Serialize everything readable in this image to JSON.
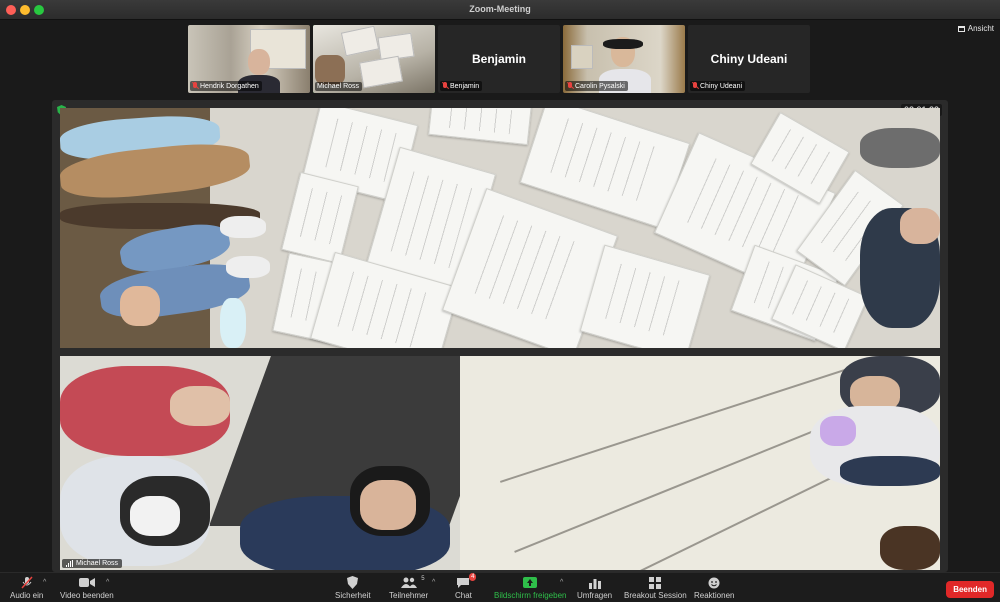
{
  "window": {
    "title": "Zoom-Meeting"
  },
  "view": {
    "label": "Ansicht"
  },
  "participants": [
    {
      "name": "Hendrik Dorgathen",
      "video": true,
      "muted": true,
      "active": false
    },
    {
      "name": "Michael Ross",
      "video": true,
      "muted": false,
      "active": true
    },
    {
      "name": "Benjamin",
      "video": false,
      "muted": true,
      "active": false,
      "display_name": "Benjamin"
    },
    {
      "name": "Carolin Pysalski",
      "video": true,
      "muted": true,
      "active": false
    },
    {
      "name": "Chiny Udeani",
      "video": false,
      "muted": true,
      "active": false,
      "display_name": "Chiny Udeani"
    }
  ],
  "main": {
    "timer": "02:01:23",
    "label": "Michael Ross"
  },
  "toolbar": {
    "audio": "Audio ein",
    "video": "Video beenden",
    "security": "Sicherheit",
    "participants": "Teilnehmer",
    "participants_count": "5",
    "chat": "Chat",
    "chat_badge": "4",
    "share": "Bildschirm freigeben",
    "polls": "Umfragen",
    "breakout": "Breakout Session",
    "reactions": "Reaktionen",
    "end": "Beenden"
  },
  "colors": {
    "accent_green": "#2fbf4a",
    "end_red": "#e02828",
    "muted_red": "#e8433f"
  }
}
